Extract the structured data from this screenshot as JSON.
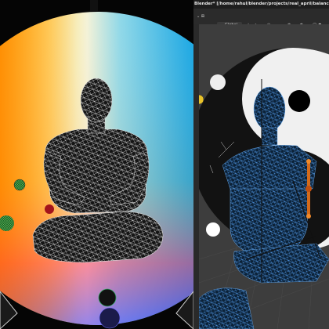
{
  "window": {
    "title": "Blender* [/home/rahul/blender/projects/real_april/balanced_"
  },
  "header": {
    "orientation_label": "Global",
    "dropdown_glyph": "⌄"
  },
  "colors": {
    "render_background": "#050505",
    "viewport_background": "#3d3d3d",
    "mesh_wireframe": "#ffffff",
    "mesh_selected": "#2f6fb5",
    "gradient": [
      "#ffd21a",
      "#f5f5dc",
      "#1aa7e8",
      "#ff3a3a",
      "#ff8a00"
    ]
  }
}
